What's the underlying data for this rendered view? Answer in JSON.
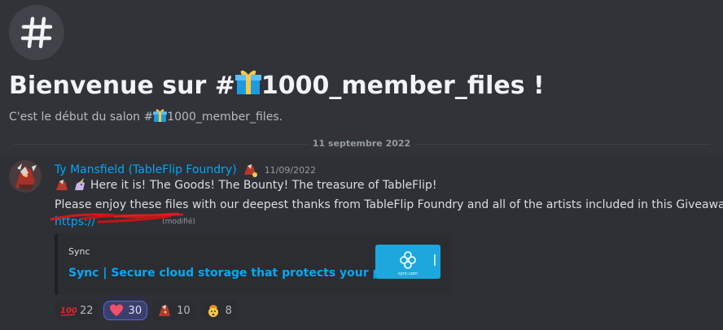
{
  "channel": {
    "icon": "hash-icon",
    "welcome_prefix": "Bienvenue sur #",
    "channel_name": "1000_member_files",
    "welcome_suffix": " !",
    "subtitle_prefix": "C'est le début du salon #",
    "subtitle_suffix": "."
  },
  "divider": {
    "date": "11 septembre 2022"
  },
  "message": {
    "author": "Ty Mansfield (TableFlip Foundry)",
    "timestamp": "11/09/2022",
    "line1": "Here it is! The Goods! The Bounty! The treasure of TableFlip!",
    "line2": "Please enjoy these files with our deepest thanks from TableFlip Foundry and all of the artists included in this Giveaway.",
    "link": "https://",
    "edited": "(modifié)"
  },
  "embed": {
    "provider": "Sync",
    "title": "Sync | Secure cloud storage that protects your privacy",
    "thumb_text": "sync.com"
  },
  "reactions": [
    {
      "emoji": "hundred-points-icon",
      "count": "22",
      "active": false
    },
    {
      "emoji": "heart-icon",
      "count": "30",
      "active": true
    },
    {
      "emoji": "dragon-emoji-icon",
      "count": "10",
      "active": false
    },
    {
      "emoji": "exploding-head-icon",
      "count": "8",
      "active": false
    }
  ],
  "colors": {
    "background": "#313338",
    "link": "#00a8fc",
    "sync_blue": "#1ea7dd",
    "active_reaction": "#5865f2"
  }
}
